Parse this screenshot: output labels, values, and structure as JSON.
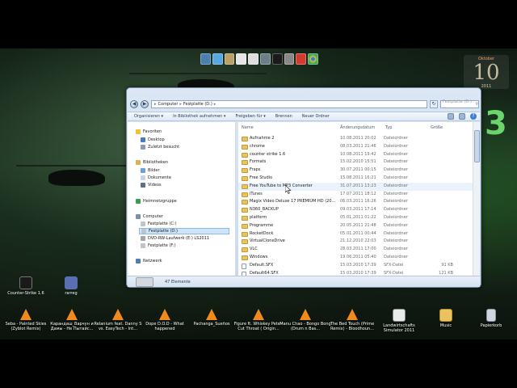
{
  "window": {
    "address": [
      "Computer",
      "Festplatte (D:)"
    ],
    "search_placeholder": "Festplatte (D:) ..."
  },
  "toolbar": {
    "organize": "Organisieren ▾",
    "library": "In Bibliothek aufnehmen ▾",
    "share": "Freigeben für ▾",
    "burn": "Brennen",
    "new_folder": "Neuer Ordner"
  },
  "nav": {
    "favorites": "Favoriten",
    "desktop": "Desktop",
    "recent": "Zuletzt besucht",
    "libraries": "Bibliotheken",
    "pictures": "Bilder",
    "documents": "Dokumente",
    "videos": "Videos",
    "homegroup": "Heimnetzgruppe",
    "computer": "Computer",
    "drive_c": "Festplatte (C:)",
    "drive_d": "Festplatte (D:)",
    "dvd": "DVD-RW-Laufwerk (E:) LS2011",
    "drive_f": "Festplatte (F:)",
    "network": "Netzwerk"
  },
  "columns": {
    "name": "Name",
    "date": "Änderungsdatum",
    "type": "Typ",
    "size": "Größe"
  },
  "files": [
    {
      "name": "Aufnahme 2",
      "date": "10.08.2011 20:02",
      "type": "Dateiordner",
      "size": ""
    },
    {
      "name": "chrome",
      "date": "08.03.2011 21:46",
      "type": "Dateiordner",
      "size": ""
    },
    {
      "name": "counter strike 1.6",
      "date": "10.08.2011 19:42",
      "type": "Dateiordner",
      "size": ""
    },
    {
      "name": "Formats",
      "date": "15.02.2010 15:51",
      "type": "Dateiordner",
      "size": ""
    },
    {
      "name": "Fraps",
      "date": "30.07.2011 00:15",
      "type": "Dateiordner",
      "size": ""
    },
    {
      "name": "Free Studio",
      "date": "15.08.2011 16:21",
      "type": "Dateiordner",
      "size": ""
    },
    {
      "name": "Free YouTube to MP3 Converter",
      "date": "31.07.2011 13:23",
      "type": "Dateiordner",
      "size": ""
    },
    {
      "name": "iTunes",
      "date": "17.07.2011 18:12",
      "type": "Dateiordner",
      "size": ""
    },
    {
      "name": "Magix Video Deluxe 17 PREMIUM HD (20...",
      "date": "06.03.2011 16:26",
      "type": "Dateiordner",
      "size": ""
    },
    {
      "name": "N360_BACKUP",
      "date": "09.03.2011 17:14",
      "type": "Dateiordner",
      "size": ""
    },
    {
      "name": "platform",
      "date": "05.01.2011 01:22",
      "type": "Dateiordner",
      "size": ""
    },
    {
      "name": "Programme",
      "date": "20.05.2011 21:48",
      "type": "Dateiordner",
      "size": ""
    },
    {
      "name": "RocketDock",
      "date": "05.01.2011 00:44",
      "type": "Dateiordner",
      "size": ""
    },
    {
      "name": "VirtualCloneDrive",
      "date": "21.12.2010 22:03",
      "type": "Dateiordner",
      "size": ""
    },
    {
      "name": "VLC",
      "date": "28.03.2011 17:00",
      "type": "Dateiordner",
      "size": ""
    },
    {
      "name": "Windows",
      "date": "19.06.2011 05:40",
      "type": "Dateiordner",
      "size": ""
    },
    {
      "name": "Default.SFX",
      "date": "15.03.2010 17:39",
      "type": "SFX-Datei",
      "size": "91 KB"
    },
    {
      "name": "Default64.SFX",
      "date": "15.03.2010 17:39",
      "type": "SFX-Datei",
      "size": "121 KB"
    }
  ],
  "status": {
    "count": "47 Elemente"
  },
  "calendar": {
    "month": "Oktober",
    "day": "10",
    "year": "2011"
  },
  "desktop_icons": {
    "cs": "Counter-Strike 1.6",
    "rarreg": "rarreg",
    "seba": "Seba - Painted Skies (Zyblot Remix)",
    "karandash": "Карандаш_Варчун и Дамы - Не Пытайс...",
    "relanium": "Relanium feat. Danny S vs. EasyTech - Int...",
    "dope": "Dope D.O.D - What happened",
    "pachanga": "Pachanga_Sueños",
    "figure": "Figure ft. Whiskey Pete - Cut Throat ( Origin...",
    "manu": "Manu Chao - Bongo Bong (Drum n Bas...",
    "bedtouch": "The Bed Touch (Prime Remix) - Bloodhoun...",
    "landwirt": "Landwirtschafts Simulator 2011",
    "music": "Music",
    "trash": "Papierkorb"
  },
  "colors": {
    "accent": "#3d7fd1",
    "folder": "#e8c35e",
    "vlc": "#f08a1c"
  }
}
